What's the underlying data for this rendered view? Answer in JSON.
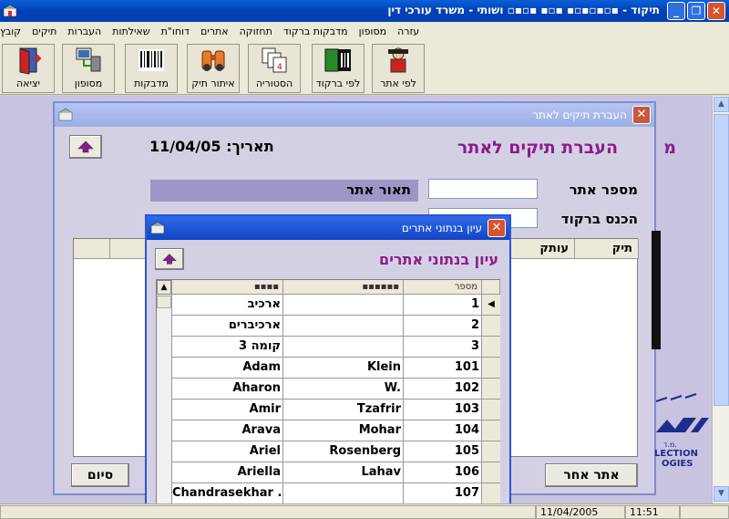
{
  "window": {
    "title": "תיקוד - ▪▫▪▫▪▫▪ ▪▫▪ ▪▫▪▫ ושותי - משרד עורכי דין"
  },
  "menu": [
    "קובץ",
    "תיקים",
    "העברות",
    "שאילתות",
    "דוחו\"ת",
    "אתרים",
    "תחזוקה",
    "מדבקות ברקוד",
    "מסופון",
    "עזרה"
  ],
  "toolbar": {
    "buttons": [
      {
        "label": "לפי אתר",
        "icon": "person-site-icon"
      },
      {
        "label": "לפי ברקוד",
        "icon": "barcode-person-icon"
      },
      {
        "label": "הסטוריה",
        "icon": "history-pages-icon"
      },
      {
        "label": "איתור תיק",
        "icon": "binoculars-icon"
      },
      {
        "label": "מדבקות",
        "icon": "barcode-icon"
      },
      {
        "label": "מסופון",
        "icon": "terminal-icon"
      },
      {
        "label": "יציאה",
        "icon": "exit-door-icon"
      }
    ]
  },
  "back_dialog": {
    "title": "העברת תיקים לאתר",
    "heading": "העברת תיקים לאתר",
    "date_label": "תאריך:",
    "date_value": "11/04/05",
    "site_number_label": "מספר אתר",
    "site_desc_label": "תאור אתר",
    "barcode_label": "הכנס ברקוד",
    "grid_headers": [
      "תיק",
      "עותק"
    ],
    "other_site_button": "אתר אחר",
    "finish_button": "סיום",
    "background_partial_text": "מ",
    "logo_text_1": "LECTION",
    "logo_text_2": "OGIES",
    "logo_small": "מ.ד."
  },
  "front_dialog": {
    "title": "עיון בנתוני אתרים",
    "heading": "עיון בנתוני אתרים",
    "columns": [
      "מספר",
      "▪▪▪▪▪▪",
      "▪▪▪▪"
    ],
    "rows": [
      {
        "number": "1",
        "col2": "",
        "col3": "ארכיב"
      },
      {
        "number": "2",
        "col2": "",
        "col3": "ארכיברים"
      },
      {
        "number": "3",
        "col2": "",
        "col3": "קומה 3"
      },
      {
        "number": "101",
        "col2": "Klein",
        "col3": "Adam"
      },
      {
        "number": "102",
        "col2": "W.",
        "col3": "Aharon"
      },
      {
        "number": "103",
        "col2": "Tzafrir",
        "col3": "Amir"
      },
      {
        "number": "104",
        "col2": "Mohar",
        "col3": "Arava"
      },
      {
        "number": "105",
        "col2": "Rosenberg",
        "col3": "Ariel"
      },
      {
        "number": "106",
        "col2": "Lahav",
        "col3": "Ariella"
      },
      {
        "number": "107",
        "col2": "",
        "col3": "Chandrasekhar ."
      }
    ]
  },
  "status": {
    "date": "11/04/2005",
    "time": "11:51"
  }
}
